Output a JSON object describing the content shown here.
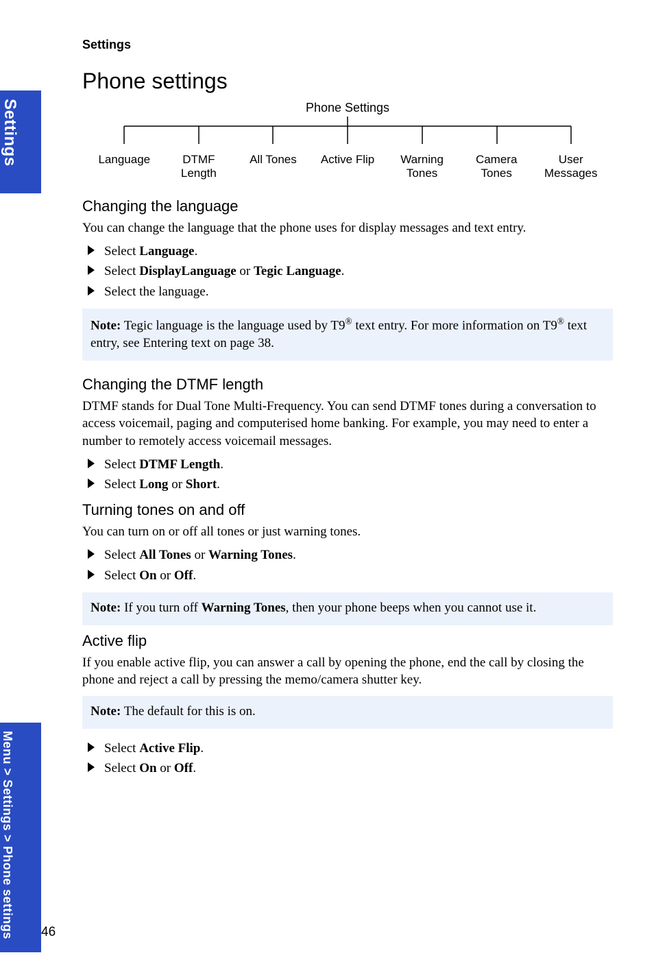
{
  "side": {
    "top": "Settings",
    "bottom": "Menu > Settings > Phone settings"
  },
  "page_number": "46",
  "header": "Settings",
  "h1": "Phone settings",
  "tree": {
    "root": "Phone Settings",
    "leaves": [
      "Language",
      "DTMF\nLength",
      "All Tones",
      "Active Flip",
      "Warning\nTones",
      "Camera\nTones",
      "User\nMessages"
    ]
  },
  "sec_lang": {
    "title": "Changing the language",
    "intro": "You can change the language that the phone uses for display messages and text entry.",
    "b1_pre": "Select ",
    "b1_bold": "Language",
    "b1_post": ".",
    "b2_pre": "Select ",
    "b2_bold1": "DisplayLanguage",
    "b2_mid": " or ",
    "b2_bold2": "Tegic Language",
    "b2_post": ".",
    "b3": "Select the language.",
    "note_label": "Note:",
    "note_p1": " Tegic language is the language used by T9",
    "note_sup1": "®",
    "note_p2": " text entry. For more information on T9",
    "note_sup2": "®",
    "note_p3": " text entry, see Entering text on page 38."
  },
  "sec_dtmf": {
    "title": "Changing the DTMF length",
    "intro": "DTMF stands for Dual Tone Multi-Frequency. You can send DTMF tones during a conversation to access voicemail, paging and computerised home banking. For example, you may need to enter a number to remotely access voicemail messages.",
    "b1_pre": "Select ",
    "b1_bold": "DTMF Length",
    "b1_post": ".",
    "b2_pre": "Select ",
    "b2_bold1": "Long",
    "b2_mid": " or ",
    "b2_bold2": "Short",
    "b2_post": "."
  },
  "sec_tones": {
    "title": "Turning tones on and off",
    "intro": "You can turn on or off all tones or just warning tones.",
    "b1_pre": "Select ",
    "b1_bold1": "All Tones",
    "b1_mid": " or ",
    "b1_bold2": "Warning Tones",
    "b1_post": ".",
    "b2_pre": "Select ",
    "b2_bold1": "On",
    "b2_mid": " or ",
    "b2_bold2": "Off",
    "b2_post": ".",
    "note_label": "Note:",
    "note_p1": " If you turn off ",
    "note_bold": "Warning Tones",
    "note_p2": ", then your phone beeps when you cannot use it."
  },
  "sec_flip": {
    "title": "Active flip",
    "intro": "If you enable active flip, you can answer a call by opening the phone, end the call by closing the phone and reject a call by pressing the memo/camera shutter key.",
    "note_label": "Note:",
    "note_text": " The default for this is on.",
    "b1_pre": "Select ",
    "b1_bold": "Active Flip",
    "b1_post": ".",
    "b2_pre": "Select ",
    "b2_bold1": "On",
    "b2_mid": " or ",
    "b2_bold2": "Off",
    "b2_post": "."
  }
}
